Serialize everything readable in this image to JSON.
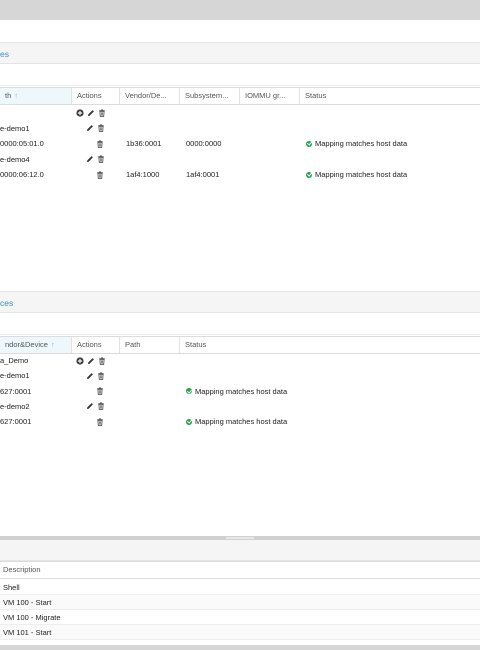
{
  "panels": {
    "pci_title": "es",
    "usb_title": "ces"
  },
  "pci_grid": {
    "columns": [
      "th",
      "Actions",
      "Vendor/De...",
      "Subsystem...",
      "IOMMU gr...",
      "Status"
    ],
    "sorted_arrow": "↑",
    "rows": [
      {
        "name": "",
        "actions": [
          "add",
          "edit",
          "delete"
        ],
        "vendor": "",
        "subsystem": "",
        "iommu": "",
        "status": ""
      },
      {
        "name": "e-demo1",
        "actions": [
          "edit",
          "delete"
        ],
        "vendor": "",
        "subsystem": "",
        "iommu": "",
        "status": ""
      },
      {
        "name": "0000:05:01.0",
        "actions": [
          "delete"
        ],
        "vendor": "1b36:0001",
        "subsystem": "0000:0000",
        "iommu": "",
        "status": "Mapping matches host data"
      },
      {
        "name": "e-demo4",
        "actions": [
          "edit",
          "delete"
        ],
        "vendor": "",
        "subsystem": "",
        "iommu": "",
        "status": ""
      },
      {
        "name": "0000:06:12.0",
        "actions": [
          "delete"
        ],
        "vendor": "1af4:1000",
        "subsystem": "1af4:0001",
        "iommu": "",
        "status": "Mapping matches host data"
      }
    ]
  },
  "usb_grid": {
    "columns": [
      "ndor&Device",
      "Actions",
      "Path",
      "Status"
    ],
    "sorted_arrow": "↑",
    "rows": [
      {
        "name": "a_Demo",
        "actions": [
          "add",
          "edit",
          "delete"
        ],
        "path": "",
        "status": ""
      },
      {
        "name": "e-demo1",
        "actions": [
          "edit",
          "delete"
        ],
        "path": "",
        "status": ""
      },
      {
        "name": "627:0001",
        "actions": [
          "delete"
        ],
        "path": "",
        "status": "Mapping matches host data"
      },
      {
        "name": "e-demo2",
        "actions": [
          "edit",
          "delete"
        ],
        "path": "",
        "status": ""
      },
      {
        "name": "627:0001",
        "actions": [
          "delete"
        ],
        "path": "",
        "status": "Mapping matches host data"
      }
    ]
  },
  "desc_grid": {
    "header": "Description",
    "rows": [
      "Shell",
      "VM 100 - Start",
      "VM 100 - Migrate",
      "VM 101 - Start"
    ]
  },
  "colors": {
    "accent": "#3b8dbd",
    "ok": "#21a04a"
  }
}
